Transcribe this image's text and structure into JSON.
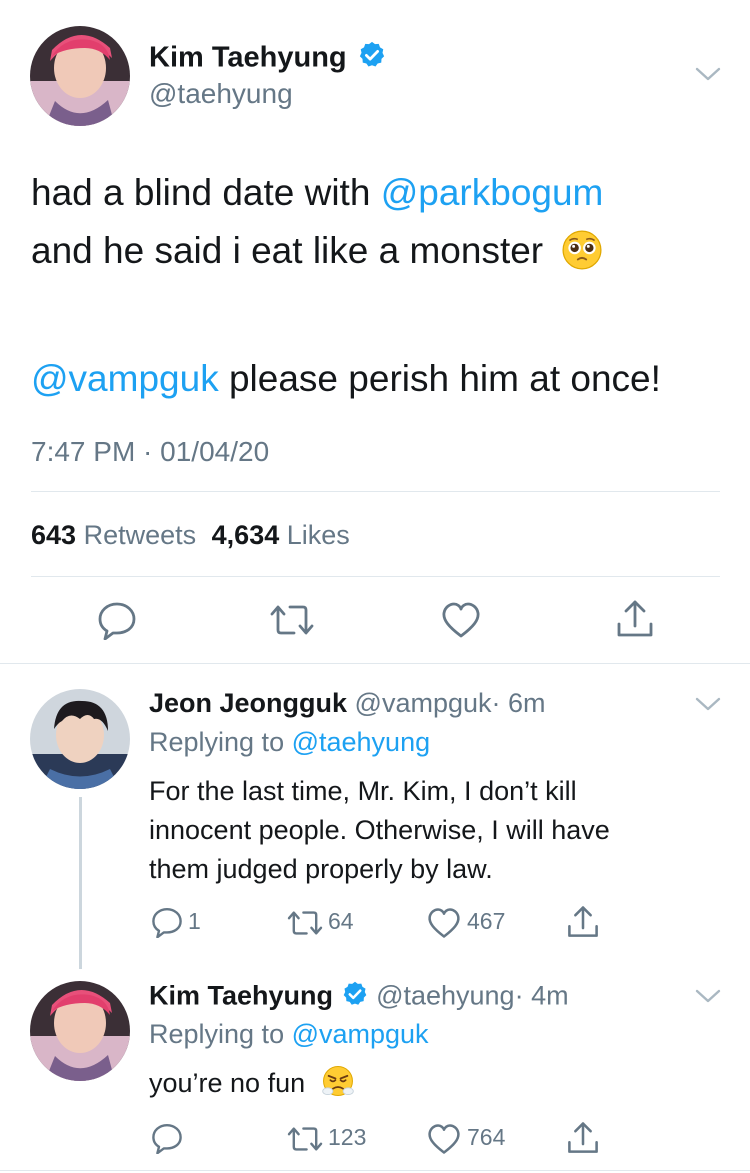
{
  "main_tweet": {
    "author_name": "Kim Taehyung",
    "author_handle": "@taehyung",
    "text_line1_plain": "had a blind date with ",
    "text_line1_mention": "@parkbogum",
    "text_line2_plain": "and he said i eat like a monster",
    "text_line2_emoji": "pleading-face",
    "text_line3_mention": "@vampguk",
    "text_line3_plain": " please perish him at once!",
    "timestamp": "7:47 PM · 01/04/20",
    "retweet_count": "643",
    "retweet_label": "Retweets",
    "like_count": "4,634",
    "like_label": "Likes"
  },
  "reply1": {
    "author_name": "Jeon Jeongguk",
    "author_handle": "@vampguk",
    "time": "· 6m",
    "replying_label": "Replying to ",
    "replying_to": "@taehyung",
    "text_line1": "For the last time, Mr. Kim, I don’t kill",
    "text_line2": "innocent people. Otherwise, I will have",
    "text_line3": "them judged properly by law.",
    "reply_count": "1",
    "retweet_count": "64",
    "like_count": "467"
  },
  "reply2": {
    "author_name": "Kim Taehyung",
    "author_handle": "@taehyung",
    "time": "· 4m",
    "replying_label": "Replying to ",
    "replying_to": "@vampguk",
    "text_plain": "you’re no fun",
    "text_emoji": "face-with-steam-from-nose",
    "reply_count": "",
    "retweet_count": "123",
    "like_count": "764"
  },
  "colors": {
    "link_blue": "#1da1f2",
    "meta_grey": "#657786",
    "divider": "#e1e8ed"
  }
}
